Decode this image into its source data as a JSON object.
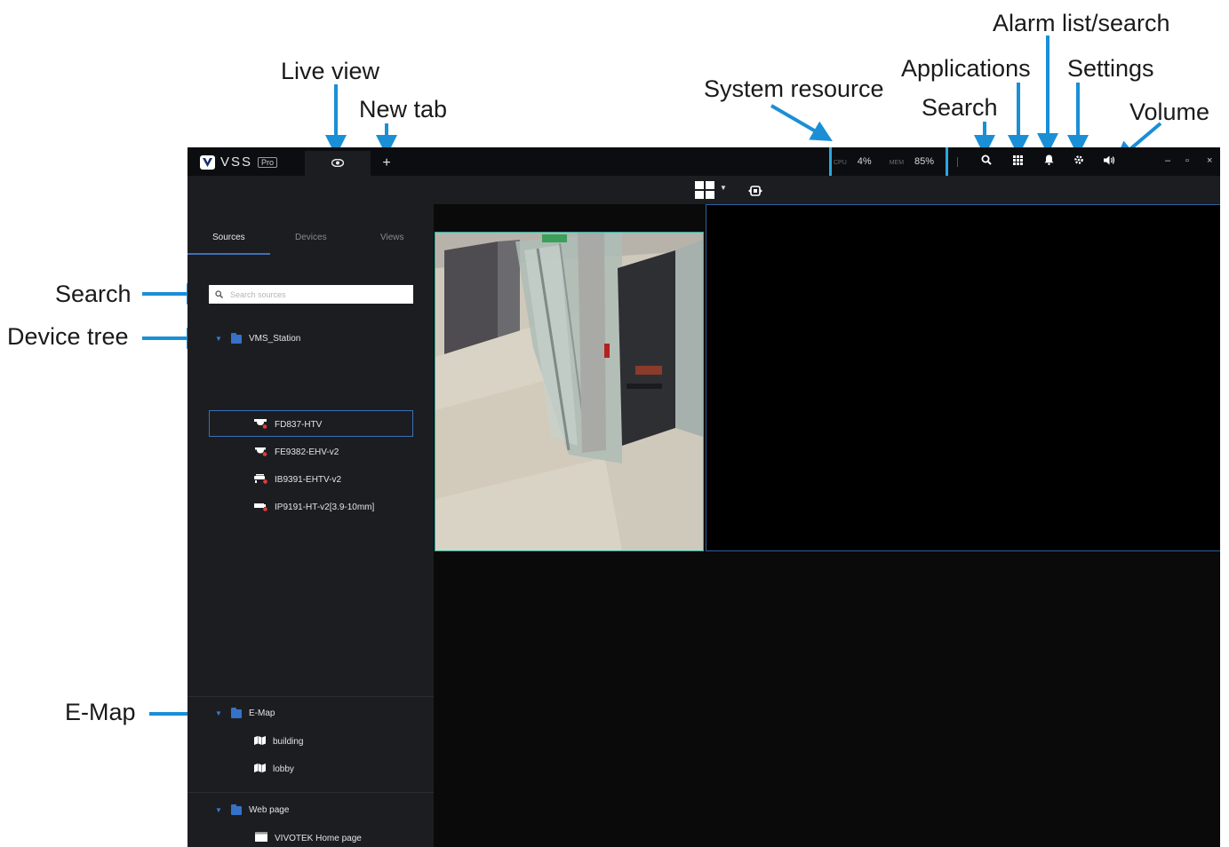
{
  "callouts": {
    "live_view": "Live view",
    "new_tab": "New tab",
    "system_resource": "System resource",
    "applications": "Applications",
    "alarm_list_search": "Alarm list/search",
    "settings": "Settings",
    "search_top": "Search",
    "volume": "Volume",
    "search_left": "Search",
    "device_tree": "Device tree",
    "emap": "E-Map"
  },
  "app": {
    "logo_text": "VSS",
    "logo_badge": "Pro",
    "new_tab_symbol": "+",
    "system": {
      "cpu_label": "CPU",
      "cpu_value": "4%",
      "mem_label": "MEM",
      "mem_value": "85%"
    },
    "window_controls": {
      "minimize": "–",
      "maximize": "▫",
      "close": "×"
    },
    "icons": {
      "live_view": "eye-icon",
      "search": "search-icon",
      "applications": "apps-grid-icon",
      "alarm": "bell-icon",
      "settings": "gear-icon",
      "volume": "speaker-icon",
      "layout": "layout-grid-icon",
      "tour": "tour-icon"
    }
  },
  "sidebar": {
    "tabs": [
      "Sources",
      "Devices",
      "Views"
    ],
    "search_placeholder": "Search sources",
    "station": "VMS_Station",
    "cameras": [
      "FD837-HTV",
      "FE9382-EHV-v2",
      "IB9391-EHTV-v2",
      "IP9191-HT-v2[3.9-10mm]"
    ],
    "emap_group": "E-Map",
    "emaps": [
      "building",
      "lobby"
    ],
    "webpage_group": "Web page",
    "webpages": [
      "VIVOTEK Home page"
    ]
  },
  "colors": {
    "accent": "#2ba8e0",
    "folder": "#3572c8",
    "selection": "#3d6fb8",
    "active_cell": "#2bb3a3",
    "alert_dot": "#e23b3b"
  }
}
